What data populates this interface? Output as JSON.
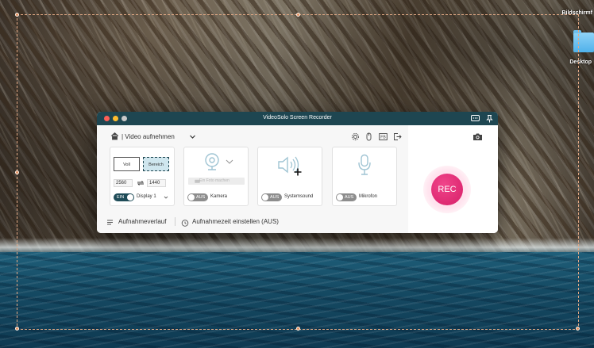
{
  "window": {
    "title": "VideoSolo Screen Recorder"
  },
  "desktop": {
    "labels": [
      "Bildschirmf",
      "Desktop"
    ]
  },
  "toolbar": {
    "mode_label": "| Video aufnehmen",
    "icons": [
      "settings-icon",
      "mouse-icon",
      "fb-icon",
      "export-icon"
    ]
  },
  "display": {
    "full_label": "Voll",
    "region_label": "Bereich",
    "width": "2560",
    "height": "1440",
    "toggle": "EIN",
    "display_name": "Display 1"
  },
  "camera": {
    "placeholder": "Ein Foto machen",
    "toggle": "AUS",
    "label": "Kamera"
  },
  "system_sound": {
    "toggle": "AUS",
    "label": "Systemsound"
  },
  "microphone": {
    "toggle": "AUS",
    "label": "Mikrofon"
  },
  "bottom": {
    "history": "Aufnahmeverlauf",
    "schedule": "Aufnahmezeit einstellen (AUS)"
  },
  "record": {
    "label": "REC"
  },
  "colors": {
    "titlebar": "#1e4651",
    "rec": "#d71e68",
    "toggle_on": "#1f4c58",
    "toggle_off": "#8d8d8d"
  }
}
